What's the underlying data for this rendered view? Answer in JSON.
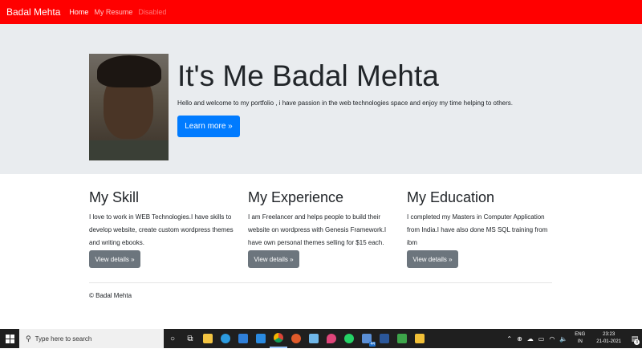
{
  "navbar": {
    "brand": "Badal Mehta",
    "links": [
      {
        "label": "Home",
        "state": "active"
      },
      {
        "label": "My Resume",
        "state": "normal"
      },
      {
        "label": "Disabled",
        "state": "disabled"
      }
    ],
    "color": "#ff0000"
  },
  "hero": {
    "title": "It's Me Badal Mehta",
    "text": "Hello and welcome to my portfolio , i have passion in the web technologies space and enjoy my time helping to others.",
    "button": "Learn more »"
  },
  "sections": [
    {
      "title": "My Skill",
      "text": "I love to work in WEB Technologies.I have skills to develop website, create custom wordpress themes and writing ebooks.",
      "button": "View details »"
    },
    {
      "title": "My Experience",
      "text": "I am Freelancer and helps people to build their website on wordpress with Genesis Framework.I have own personal themes selling for $15 each.",
      "button": "View details »"
    },
    {
      "title": "My Education",
      "text": "I completed my Masters in Computer Application from India.I have also done MS SQL training from ibm",
      "button": "View details »"
    }
  ],
  "footer": "© Badal Mehta",
  "taskbar": {
    "search_placeholder": "Type here to search",
    "lang_top": "ENG",
    "lang_bottom": "IN",
    "time": "23:23",
    "date": "21-01-2021",
    "badge": "44",
    "notif_count": "3"
  }
}
